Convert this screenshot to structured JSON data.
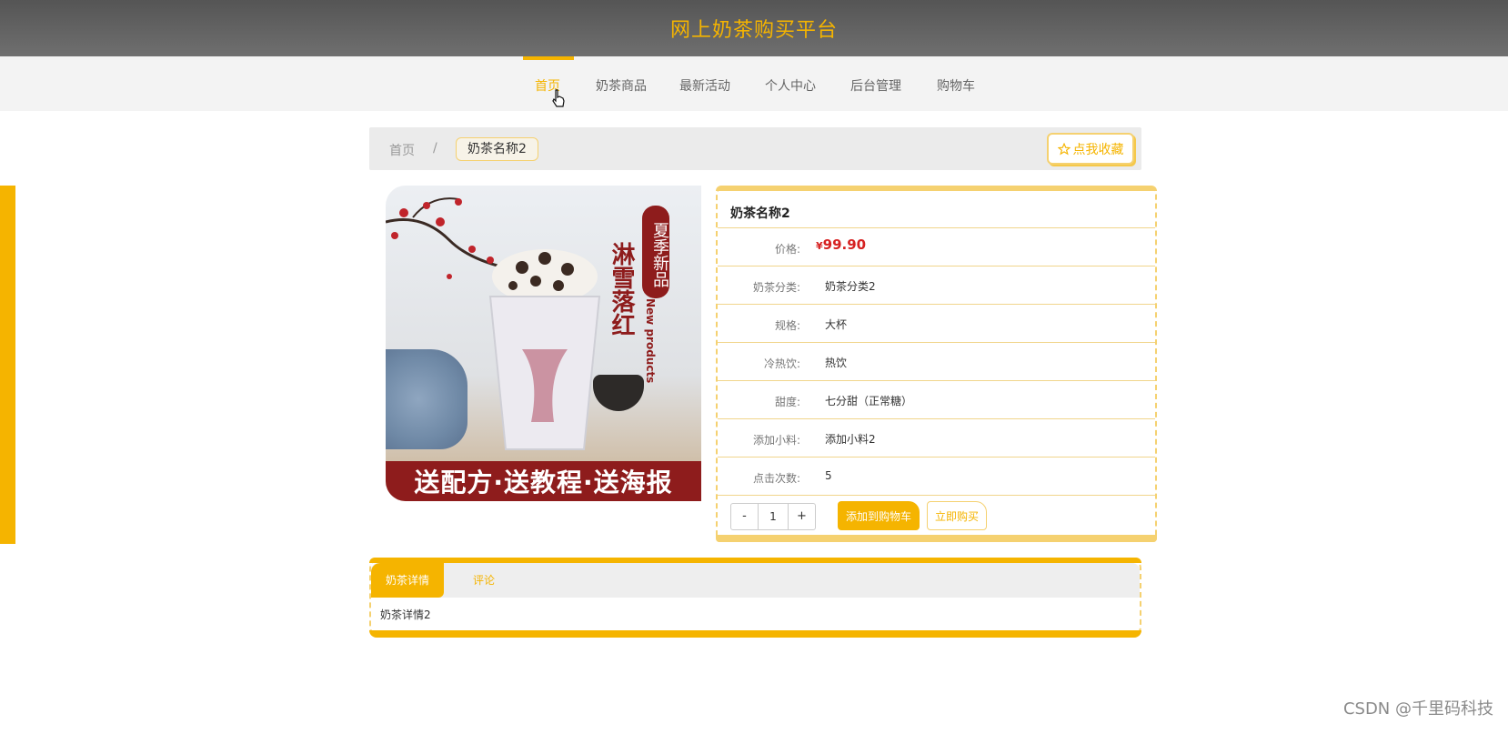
{
  "header": {
    "title": "网上奶茶购买平台"
  },
  "nav": {
    "items": [
      {
        "label": "首页",
        "active": true
      },
      {
        "label": "奶茶商品",
        "active": false
      },
      {
        "label": "最新活动",
        "active": false
      },
      {
        "label": "个人中心",
        "active": false
      },
      {
        "label": "后台管理",
        "active": false
      },
      {
        "label": "购物车",
        "active": false
      }
    ]
  },
  "breadcrumb": {
    "home": "首页",
    "separator": "/",
    "current": "奶茶名称2"
  },
  "favorite": {
    "label": "点我收藏",
    "icon": "star-icon"
  },
  "product_image": {
    "vertical_badge": "夏季新品",
    "vertical_title": "淋雪落红",
    "english": "New products",
    "band": "送配方·送教程·送海报"
  },
  "product": {
    "name": "奶茶名称2",
    "price_label": "价格:",
    "price_symbol": "¥",
    "price_value": "99.90",
    "attributes": [
      {
        "label": "奶茶分类:",
        "value": "奶茶分类2"
      },
      {
        "label": "规格:",
        "value": "大杯"
      },
      {
        "label": "冷热饮:",
        "value": "热饮"
      },
      {
        "label": "甜度:",
        "value": "七分甜（正常糖）"
      },
      {
        "label": "添加小料:",
        "value": "添加小料2"
      },
      {
        "label": "点击次数:",
        "value": "5"
      }
    ],
    "quantity": {
      "minus": "-",
      "value": "1",
      "plus": "+"
    },
    "add_to_cart": "添加到购物车",
    "buy_now": "立即购买"
  },
  "tabs": {
    "items": [
      {
        "label": "奶茶详情",
        "active": true
      },
      {
        "label": "评论",
        "active": false
      }
    ],
    "content": "奶茶详情2"
  },
  "watermark": "CSDN @千里码科技",
  "colors": {
    "accent": "#f5b400",
    "price": "#d62222",
    "header": "#5f5f5f",
    "band": "#8e1c1c"
  }
}
